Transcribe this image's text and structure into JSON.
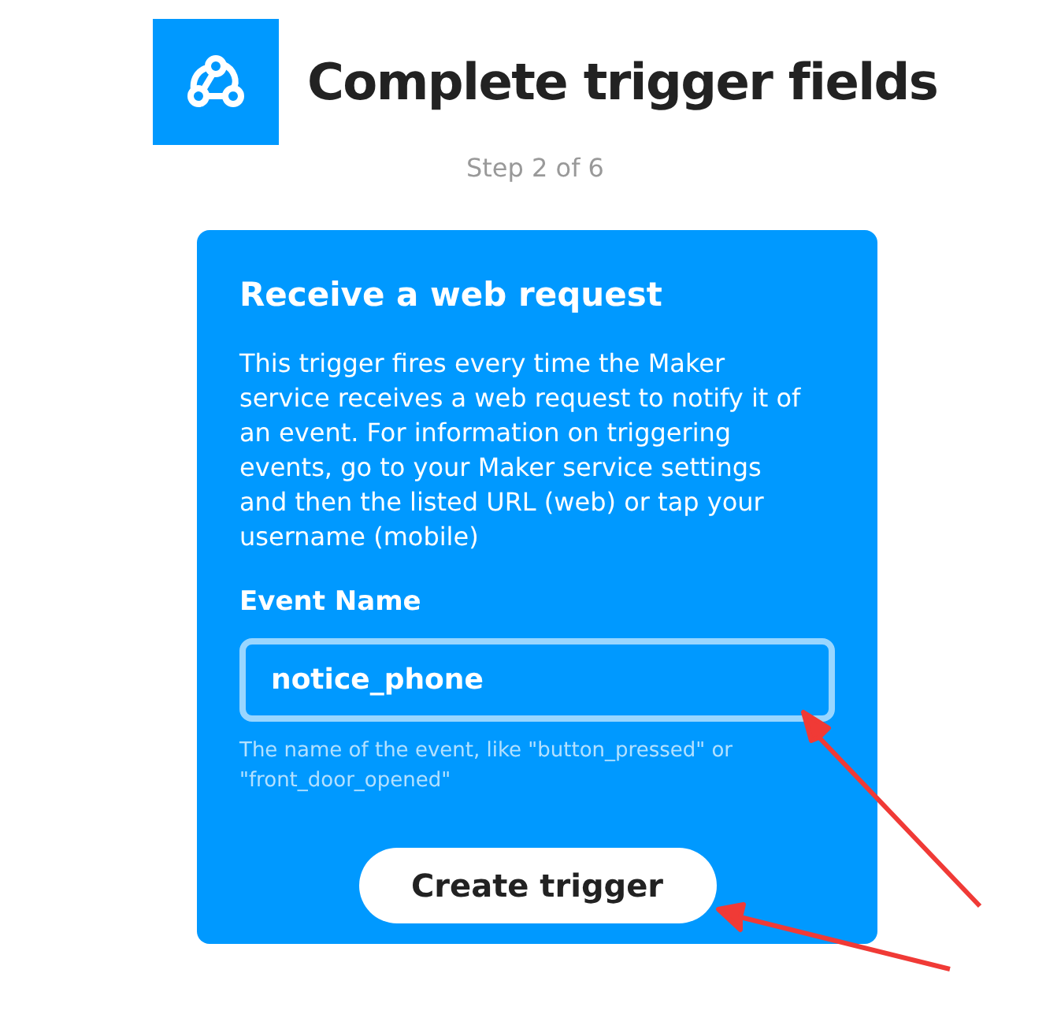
{
  "header": {
    "title": "Complete trigger fields",
    "step": "Step 2 of 6"
  },
  "card": {
    "title": "Receive a web request",
    "description": "This trigger fires every time the Maker service receives a web request to notify it of an event. For information on triggering events, go to your Maker service settings and then the listed URL (web) or tap your username (mobile)",
    "field": {
      "label": "Event Name",
      "value": "notice_phone",
      "hint": "The name of the event, like \"button_pressed\" or \"front_door_opened\""
    },
    "button": "Create trigger"
  }
}
